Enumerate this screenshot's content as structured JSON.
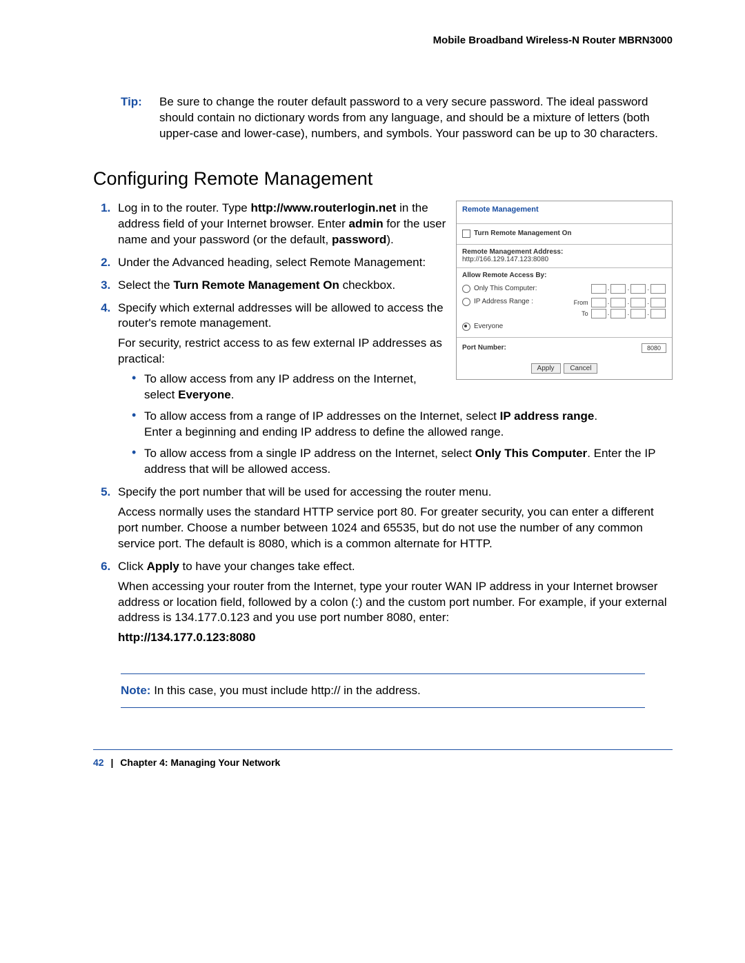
{
  "header": {
    "running_title": "Mobile Broadband Wireless-N Router MBRN3000"
  },
  "tip": {
    "label": "Tip:",
    "text": "Be sure to change the router default password to a very secure password. The ideal password should contain no dictionary words from any language, and should be a mixture of letters (both upper-case and lower-case), numbers, and symbols. Your password can be up to 30 characters."
  },
  "section": {
    "title": "Configuring Remote Management"
  },
  "steps": {
    "s1a": "Log in to the router. Type ",
    "s1_url": "http://www.routerlogin.net",
    "s1b": " in the address field of your Internet browser. Enter ",
    "s1_admin": "admin",
    "s1c": " for the user name and your password (or the default, ",
    "s1_pw": "password",
    "s1d": ").",
    "s2": "Under the Advanced heading, select Remote Management:",
    "s3a": "Select the ",
    "s3_bold": "Turn Remote Management On",
    "s3b": " checkbox.",
    "s4a": "Specify which external addresses will be allowed to access the router's remote management.",
    "s4b": "For security, restrict access to as few external IP addresses as practical:",
    "b1a": "To allow access from any IP address on the Internet, select ",
    "b1_bold": "Everyone",
    "b1b": ".",
    "b2a": "To allow access from a range of IP addresses on the Internet, select ",
    "b2_bold": "IP address range",
    "b2b": ".",
    "b2c": "Enter a beginning and ending IP address to define the allowed range.",
    "b3a": "To allow access from a single IP address on the Internet, select ",
    "b3_bold": "Only This Computer",
    "b3b": ". Enter the IP address that will be allowed access.",
    "s5a": "Specify the port number that will be used for accessing the router menu.",
    "s5b": "Access normally uses the standard HTTP service port 80. For greater security, you can enter a different port number. Choose a number between 1024 and 65535, but do not use the number of any common service port. The default is 8080, which is a common alternate for HTTP.",
    "s6a": "Click ",
    "s6_bold": "Apply",
    "s6b": " to have your changes take effect.",
    "s6c": "When accessing your router from the Internet, type your router WAN IP address in your Internet browser address or location field, followed by a colon (:) and the custom port number. For example, if your external address is 134.177.0.123 and you use port number 8080, enter:",
    "s6_example": "http://134.177.0.123:8080"
  },
  "figure": {
    "title": "Remote Management",
    "turn_on": "Turn Remote Management On",
    "addr_label": "Remote Management Address:",
    "addr_value": "http://166.129.147.123:8080",
    "allow_label": "Allow Remote Access By:",
    "only_this": "Only This Computer:",
    "ip_range": "IP Address Range :",
    "from": "From",
    "to": "To",
    "everyone": "Everyone",
    "port_label": "Port Number:",
    "port_value": "8080",
    "apply": "Apply",
    "cancel": "Cancel"
  },
  "note": {
    "label": "Note:",
    "text": "In this case, you must include http:// in the address."
  },
  "footer": {
    "page": "42",
    "separator": "|",
    "chapter": "Chapter 4:  Managing Your Network"
  }
}
